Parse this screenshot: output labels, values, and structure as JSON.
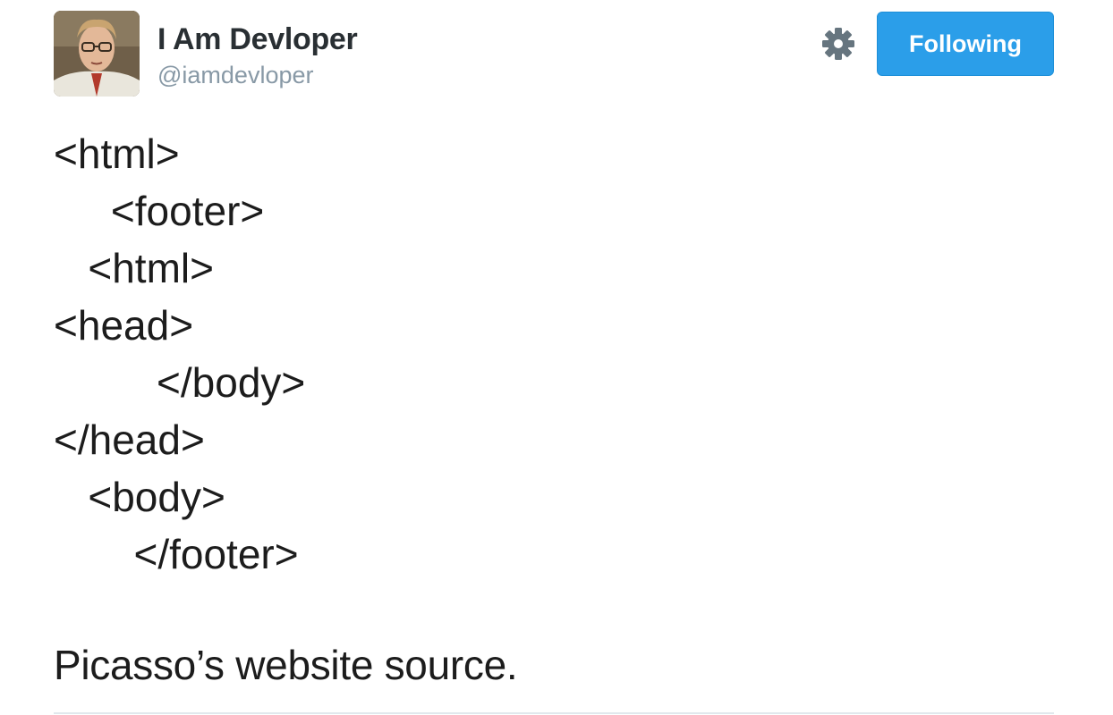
{
  "author": {
    "display_name": "I Am Devloper",
    "handle": "@iamdevloper"
  },
  "actions": {
    "follow_label": "Following",
    "settings_icon": "gear-icon"
  },
  "tweet": {
    "code_lines": [
      "<html>",
      "     <footer>",
      "   <html>",
      "<head>",
      "         </body>",
      "</head>",
      "   <body>",
      "       </footer>"
    ],
    "caption": "Picasso’s website source."
  },
  "colors": {
    "follow_button": "#2b9ee9",
    "handle_text": "#8899a6",
    "divider": "#e1e8ed"
  }
}
